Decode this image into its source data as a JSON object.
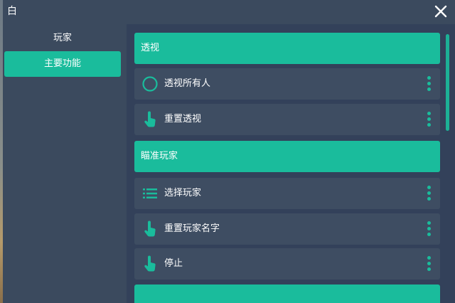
{
  "window": {
    "title": "白"
  },
  "sidebar": {
    "items": [
      {
        "label": "玩家",
        "active": false
      },
      {
        "label": "主要功能",
        "active": true
      }
    ]
  },
  "content": {
    "sections": [
      {
        "type": "header",
        "label": "透视"
      },
      {
        "type": "toggle",
        "label": "透视所有人",
        "icon": "circle-toggle-icon"
      },
      {
        "type": "button",
        "label": "重置透视",
        "icon": "tap-hand-icon"
      },
      {
        "type": "header",
        "label": "瞄准玩家"
      },
      {
        "type": "list",
        "label": "选择玩家",
        "icon": "list-icon"
      },
      {
        "type": "button",
        "label": "重置玩家名字",
        "icon": "tap-hand-icon"
      },
      {
        "type": "button",
        "label": "停止",
        "icon": "tap-hand-icon"
      },
      {
        "type": "header",
        "label": ""
      }
    ]
  },
  "colors": {
    "accent": "#1abc9c",
    "panel": "#3b4a5e",
    "content_bg": "#33415a",
    "row_bg": "#3e4d62"
  }
}
